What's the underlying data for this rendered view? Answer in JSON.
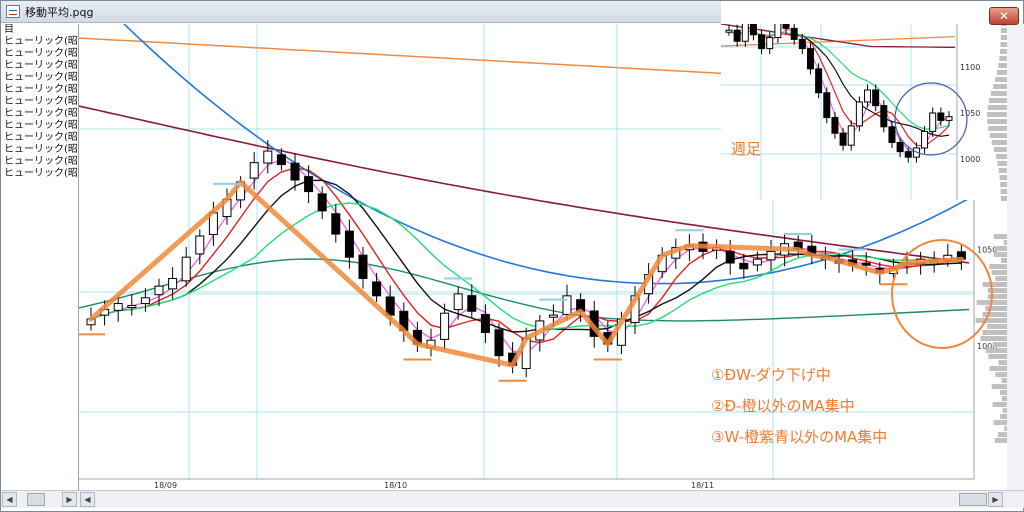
{
  "window": {
    "title": "移動平均.pqg",
    "close_label": "✕"
  },
  "sidebar": {
    "header": "目",
    "items": [
      "ヒューリック(昭",
      "ヒューリック(昭",
      "ヒューリック(昭",
      "ヒューリック(昭",
      "ヒューリック(昭",
      "ヒューリック(昭",
      "ヒューリック(昭",
      "ヒューリック(昭",
      "ヒューリック(昭",
      "ヒューリック(昭",
      "ヒューリック(昭",
      "ヒューリック(昭"
    ]
  },
  "scroll": {
    "left_arrow": "◀",
    "right_arrow": "▶"
  },
  "colors": {
    "grid": "#a8e4f0",
    "up_candle": "#ffffff",
    "down_candle": "#000000",
    "ma_black": "#111111",
    "ma_red": "#e02020",
    "ma_pink": "#ee66ee",
    "ma_green": "#22dd77",
    "ma_darkgreen": "#1c8a6a",
    "ma_blue": "#2277dd",
    "ma_maroon": "#8a1a3a",
    "ma_orange_long": "#f08a40",
    "annotation_orange": "#f0883a",
    "annotation_text": "#f07a30",
    "resistance": "#90d0e0",
    "volume_profile": "#c0c0c0"
  },
  "chart_data": [
    {
      "type": "candlestick",
      "title": "",
      "x_tick_labels": [
        "18/09",
        "18/10",
        "18/11"
      ],
      "y_tick_labels": [
        "1050",
        "1000"
      ],
      "series": [
        {
          "name": "",
          "values": [
            1014,
            1019,
            1022,
            1021,
            1025,
            1031,
            1035,
            1046,
            1057,
            1069,
            1076,
            1085,
            1095,
            1101,
            1094,
            1086,
            1080,
            1070,
            1058,
            1046,
            1035,
            1026,
            1016,
            1008,
            1001,
            1003,
            1017,
            1027,
            1018,
            1007,
            995,
            990,
            1004,
            1013,
            1016,
            1026,
            1018,
            1005,
            1001,
            1014,
            1026,
            1037,
            1047,
            1051,
            1052,
            1049,
            1051,
            1043,
            1040,
            1045,
            1049,
            1053,
            1050,
            1047,
            1046,
            1043,
            1042,
            1042,
            1038,
            1040,
            1043,
            1045,
            1044,
            1047,
            1045
          ]
        }
      ],
      "annotations": [
        "①ÐW-ダウ下げ中",
        "②Ð-橙以外のMA集中",
        "③W-橙紫青以外のMA集中"
      ]
    },
    {
      "type": "candlestick",
      "title": "",
      "panel_label": "週足",
      "y_tick_labels": [
        "1100",
        "1050",
        "1000"
      ],
      "series": [
        {
          "name": "",
          "values": [
            1140,
            1128,
            1150,
            1135,
            1120,
            1132,
            1148,
            1142,
            1130,
            1120,
            1098,
            1072,
            1045,
            1028,
            1015,
            1036,
            1062,
            1075,
            1058,
            1035,
            1018,
            1008,
            1002,
            1012,
            1030,
            1050,
            1042,
            1046
          ]
        }
      ]
    }
  ]
}
